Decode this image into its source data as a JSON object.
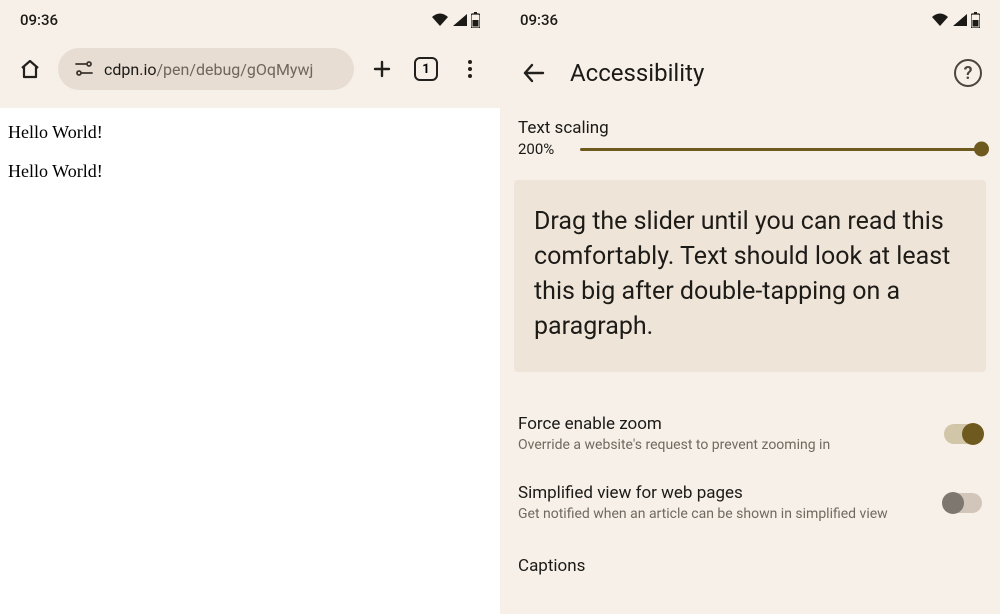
{
  "left": {
    "status": {
      "time": "09:36"
    },
    "url": {
      "domain": "cdpn.io",
      "path": "/pen/debug/gOqMywj"
    },
    "tab_count": "1",
    "content": {
      "line1": "Hello World!",
      "line2": "Hello World!"
    }
  },
  "right": {
    "status": {
      "time": "09:36"
    },
    "header": {
      "title": "Accessibility"
    },
    "text_scaling": {
      "label": "Text scaling",
      "value": "200%",
      "slider_percent": 100
    },
    "sample": {
      "text": "Drag the slider until you can read this comfortably. Text should look at least this big after double-tapping on a paragraph."
    },
    "force_zoom": {
      "title": "Force enable zoom",
      "subtitle": "Override a website's request to prevent zooming in",
      "enabled": true
    },
    "simplified": {
      "title": "Simplified view for web pages",
      "subtitle": "Get notified when an article can be shown in simplified view",
      "enabled": false
    },
    "captions": {
      "title": "Captions"
    }
  }
}
